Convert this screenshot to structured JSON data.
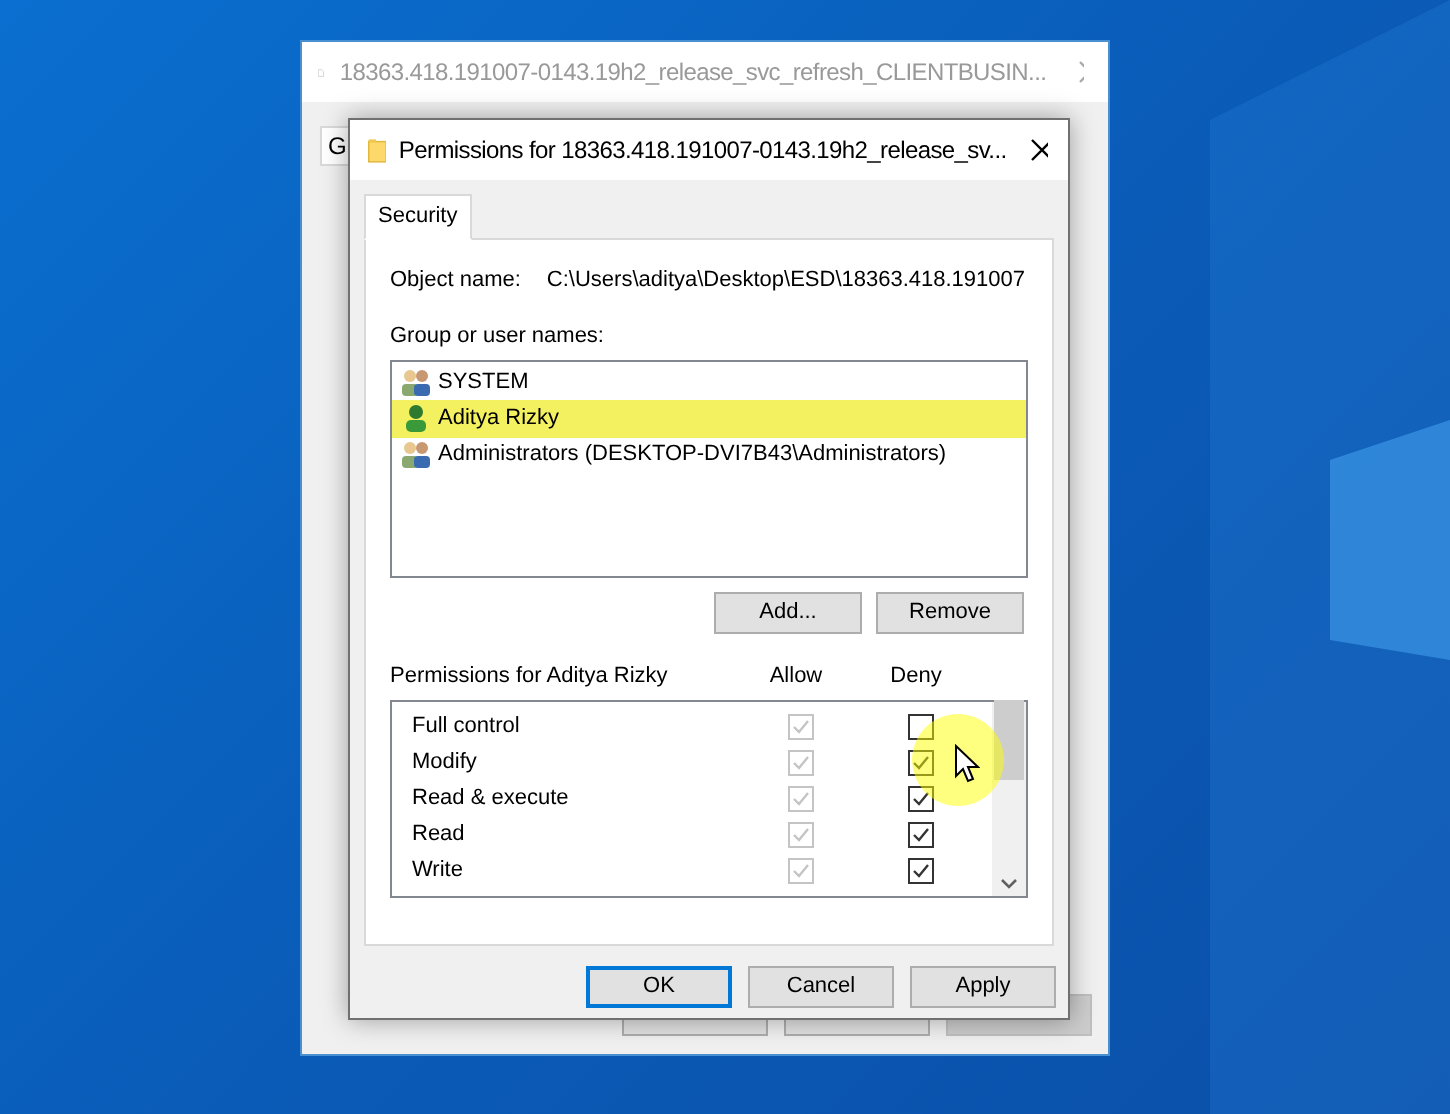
{
  "background_window": {
    "title": "18363.418.191007-0143.19h2_release_svc_refresh_CLIENTBUSIN...",
    "tab": "G",
    "buttons": [
      {
        "disabled": false
      },
      {
        "disabled": false
      },
      {
        "disabled": true
      }
    ]
  },
  "dialog": {
    "title": "Permissions for 18363.418.191007-0143.19h2_release_sv...",
    "tabs": [
      {
        "label": "Security",
        "selected": true
      }
    ],
    "object_name_label": "Object name:",
    "object_name": "C:\\Users\\aditya\\Desktop\\ESD\\18363.418.191007",
    "group_label": "Group or user names:",
    "users": [
      {
        "name": "SYSTEM",
        "kind": "group",
        "selected": false
      },
      {
        "name": "Aditya Rizky",
        "kind": "user",
        "selected": true
      },
      {
        "name": "Administrators (DESKTOP-DVI7B43\\Administrators)",
        "kind": "group",
        "selected": false
      }
    ],
    "user_buttons": [
      "Add...",
      "Remove"
    ],
    "permissions_label": "Permissions for Aditya Rizky",
    "allow_header": "Allow",
    "deny_header": "Deny",
    "permissions": [
      {
        "name": "Full control",
        "allow": true,
        "allow_disabled": true,
        "deny": false
      },
      {
        "name": "Modify",
        "allow": true,
        "allow_disabled": true,
        "deny": true
      },
      {
        "name": "Read & execute",
        "allow": true,
        "allow_disabled": true,
        "deny": true
      },
      {
        "name": "Read",
        "allow": true,
        "allow_disabled": true,
        "deny": true
      },
      {
        "name": "Write",
        "allow": true,
        "allow_disabled": true,
        "deny": true
      }
    ],
    "buttons": [
      {
        "label": "OK",
        "default": true
      },
      {
        "label": "Cancel",
        "default": false
      },
      {
        "label": "Apply",
        "default": false
      }
    ]
  }
}
